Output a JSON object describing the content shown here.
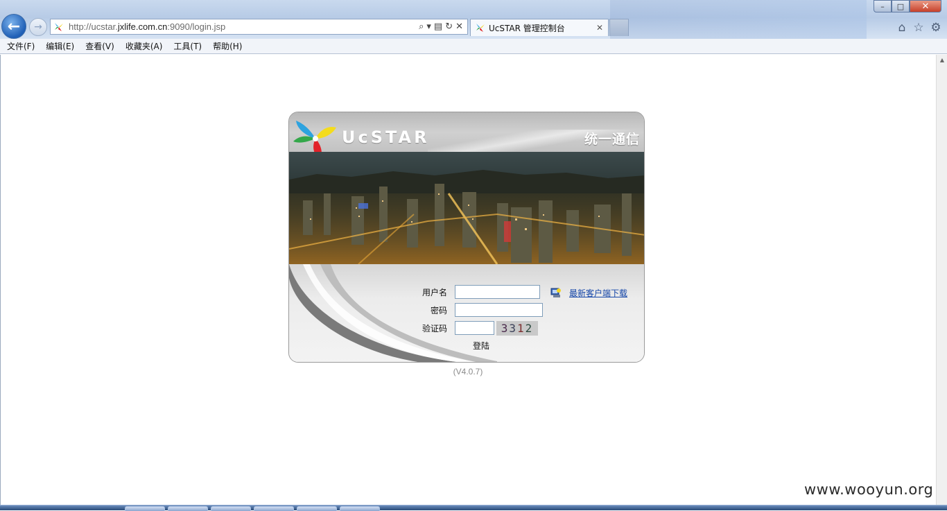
{
  "browser": {
    "url_prefix": "http://ucstar.",
    "url_domain": "jxlife.com.cn",
    "url_suffix": ":9090/login.jsp",
    "tab_title": "UcSTAR 管理控制台"
  },
  "menu": {
    "items": [
      "文件(F)",
      "编辑(E)",
      "查看(V)",
      "收藏夹(A)",
      "工具(T)",
      "帮助(H)"
    ]
  },
  "login": {
    "brand": "UcSTAR",
    "slogan": "统一通信",
    "username_label": "用户名",
    "password_label": "密码",
    "captcha_label": "验证码",
    "username_value": "",
    "password_value": "",
    "captcha_value": "",
    "captcha_digits": [
      "3",
      "3",
      "1",
      "2"
    ],
    "login_button": "登陆",
    "download_link": "最新客户端下载",
    "version": "(V4.0.7)"
  },
  "watermark": "www.wooyun.org",
  "colors": {
    "link": "#1546a8",
    "header_gray": "#c2c2c2",
    "close_button": "#c7402a"
  },
  "icons": [
    "back-arrow-icon",
    "forward-arrow-icon",
    "search-icon",
    "refresh-icon",
    "stop-icon",
    "home-icon",
    "star-icon",
    "gear-icon",
    "ucstar-logo",
    "download-client-icon"
  ]
}
